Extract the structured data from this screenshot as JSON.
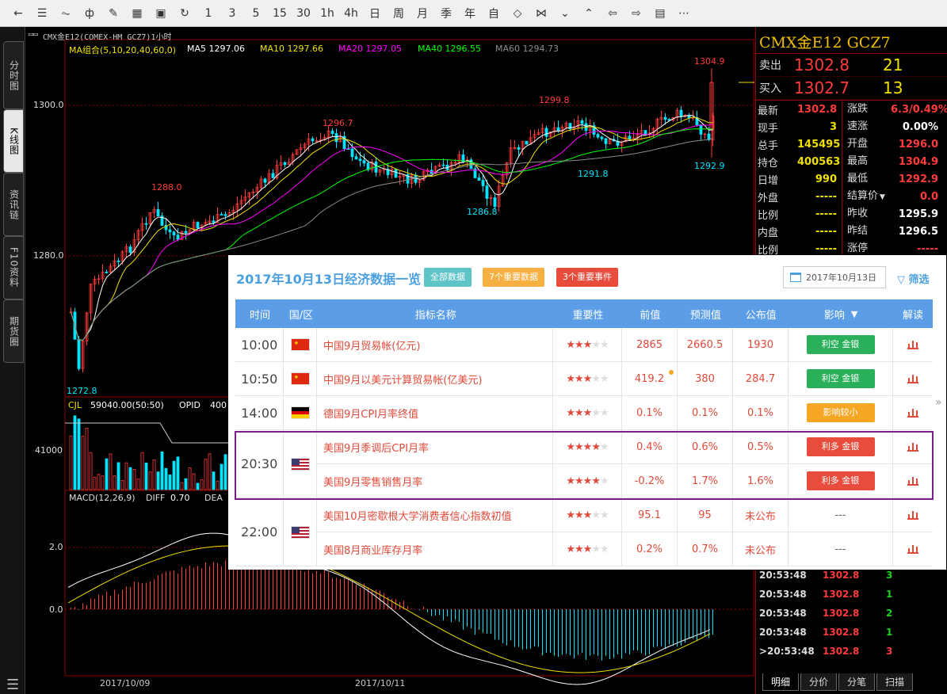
{
  "toolbar": {
    "items": [
      {
        "name": "back-icon",
        "glyph": "←"
      },
      {
        "name": "list-icon",
        "glyph": "☰"
      },
      {
        "name": "line-chart-icon",
        "glyph": "⏦"
      },
      {
        "name": "candle-icon",
        "glyph": "ф"
      },
      {
        "name": "draw-icon",
        "glyph": "✎"
      },
      {
        "name": "calc-icon",
        "glyph": "▦"
      },
      {
        "name": "save-icon",
        "glyph": "▣"
      },
      {
        "name": "refresh-icon",
        "glyph": "↻"
      },
      {
        "name": "period-1",
        "glyph": "1"
      },
      {
        "name": "period-3",
        "glyph": "3"
      },
      {
        "name": "period-5",
        "glyph": "5"
      },
      {
        "name": "period-15",
        "glyph": "15"
      },
      {
        "name": "period-30",
        "glyph": "30"
      },
      {
        "name": "period-1h",
        "glyph": "1h"
      },
      {
        "name": "period-4h",
        "glyph": "4h"
      },
      {
        "name": "period-day",
        "glyph": "日"
      },
      {
        "name": "period-week",
        "glyph": "周"
      },
      {
        "name": "period-month",
        "glyph": "月"
      },
      {
        "name": "period-quarter",
        "glyph": "季"
      },
      {
        "name": "period-year",
        "glyph": "年"
      },
      {
        "name": "period-custom",
        "glyph": "自"
      },
      {
        "name": "zoom-in-icon",
        "glyph": "◇"
      },
      {
        "name": "zoom-out-icon",
        "glyph": "⋈"
      },
      {
        "name": "down-icon",
        "glyph": "⌄"
      },
      {
        "name": "up-icon",
        "glyph": "⌃"
      },
      {
        "name": "left-icon",
        "glyph": "⇦"
      },
      {
        "name": "right-icon",
        "glyph": "⇨"
      },
      {
        "name": "layout-icon",
        "glyph": "▤"
      },
      {
        "name": "more-icon",
        "glyph": "⋯"
      }
    ]
  },
  "lefttabs": [
    "分时图",
    "K线图",
    "资讯链",
    "F10资料",
    "期货圈"
  ],
  "chart": {
    "title": "CMX金E12(COMEX-HM GCZ7)1小时",
    "ma_label": "MA组合(5,10,20,40,60,0)",
    "ma5": "MA5 1297.06",
    "ma10": "MA10 1297.66",
    "ma20": "MA20 1297.05",
    "ma40": "MA40 1296.55",
    "ma60": "MA60 1294.73",
    "y1": "1300.0",
    "y2": "1280.0",
    "peak1": "1288.0",
    "peak2": "1296.7",
    "peak3": "1299.8",
    "peak4": "1304.9",
    "low1": "1286.8",
    "low2": "1291.8",
    "low3": "1292.9",
    "low_left": "1272.8",
    "cjl_label": "CJL",
    "cjl_val": "59040.00(50:50)",
    "opid_label": "OPID",
    "opid_val": "400",
    "vol_y": "41000",
    "macd_label": "MACD(12,26,9)",
    "diff_label": "DIFF",
    "diff_val": "0.70",
    "dea_label": "DEA",
    "macd_y1": "2.0",
    "macd_y2": "0.0",
    "date1": "2017/10/09",
    "date2": "2017/10/11",
    "colors": {
      "up": "#ff3b3b",
      "down": "#00e5ff",
      "ma5": "#ffffff",
      "ma10": "#f0e000",
      "ma20": "#ff00ff",
      "ma40": "#00ff00",
      "ma60": "#8c8c8c"
    }
  },
  "quote": {
    "title": "CMX金E12  GCZ7",
    "sell_label": "卖出",
    "sell_price": "1302.8",
    "sell_vol": "21",
    "buy_label": "买入",
    "buy_price": "1302.7",
    "buy_vol": "13",
    "rows": [
      {
        "k1": "最新",
        "v1": "1302.8",
        "c1": "#ff3b3b",
        "k2": "涨跌",
        "v2": "6.3/0.49%",
        "c2": "#ff3b3b"
      },
      {
        "k1": "现手",
        "v1": "3",
        "c1": "#f0e000",
        "k2": "速涨",
        "v2": "0.00%",
        "c2": "#ffffff"
      },
      {
        "k1": "总手",
        "v1": "145495",
        "c1": "#f0e000",
        "k2": "开盘",
        "v2": "1296.0",
        "c2": "#ff3b3b"
      },
      {
        "k1": "持仓",
        "v1": "400563",
        "c1": "#f0e000",
        "k2": "最高",
        "v2": "1304.9",
        "c2": "#ff3b3b"
      },
      {
        "k1": "日增",
        "v1": "990",
        "c1": "#f0e000",
        "k2": "最低",
        "v2": "1292.9",
        "c2": "#ff3b3b"
      },
      {
        "k1": "外盘",
        "v1": "-----",
        "c1": "#f0e000",
        "k2": "结算价",
        "v2": "0.0",
        "c2": "#ff3b3b"
      },
      {
        "k1": "比例",
        "v1": "-----",
        "c1": "#f0e000",
        "k2": "昨收",
        "v2": "1295.9",
        "c2": "#ffffff"
      },
      {
        "k1": "内盘",
        "v1": "-----",
        "c1": "#f0e000",
        "k2": "昨结",
        "v2": "1296.5",
        "c2": "#ffffff"
      },
      {
        "k1": "比例",
        "v1": "-----",
        "c1": "#f0e000",
        "k2": "涨停",
        "v2": "-----",
        "c2": "#ff3b3b"
      }
    ],
    "ticks": [
      {
        "t": "20:53:48",
        "p": "1302.8",
        "v": "3",
        "red": false
      },
      {
        "t": "20:53:48",
        "p": "1302.8",
        "v": "1",
        "red": false
      },
      {
        "t": "20:53:48",
        "p": "1302.8",
        "v": "2",
        "red": false
      },
      {
        "t": "20:53:48",
        "p": "1302.8",
        "v": "1",
        "red": false
      },
      {
        "t": ">20:53:48",
        "p": "1302.8",
        "v": "3",
        "red": true
      }
    ],
    "bottomtabs": [
      "明细",
      "分价",
      "分笔",
      "扫描"
    ]
  },
  "econ": {
    "title": "2017年10月13日经济数据一览",
    "pill_all": "全部数据",
    "pill_important": "7个重要数据",
    "pill_events": "3个重要事件",
    "date": "2017年10月13日",
    "filter": "筛选",
    "headers": {
      "time": "时间",
      "region": "国/区",
      "name": "指标名称",
      "importance": "重要性",
      "prev": "前值",
      "forecast": "预测值",
      "actual": "公布值",
      "impact": "影响",
      "read": "解读"
    },
    "colors": {
      "bearish": "#2ab05a",
      "bullish": "#e74c3c",
      "neutral": "#f5a623"
    },
    "groups": [
      {
        "time": "10:00",
        "flag": "cn",
        "rows": [
          {
            "name": "中国9月贸易帐(亿元)",
            "stars": 3,
            "prev": "2865",
            "forecast": "2660.5",
            "actual": "1930",
            "impact": "利空 金银",
            "impact_type": "bearish"
          }
        ]
      },
      {
        "time": "10:50",
        "flag": "cn",
        "rows": [
          {
            "name": "中国9月以美元计算贸易帐(亿美元)",
            "stars": 3,
            "prev": "419.2",
            "forecast": "380",
            "actual": "284.7",
            "impact": "利空 金银",
            "impact_type": "bearish",
            "dot": true
          }
        ]
      },
      {
        "time": "14:00",
        "flag": "de",
        "rows": [
          {
            "name": "德国9月CPI月率终值",
            "stars": 3,
            "prev": "0.1%",
            "forecast": "0.1%",
            "actual": "0.1%",
            "impact": "影响较小",
            "impact_type": "neutral"
          }
        ]
      },
      {
        "time": "20:30",
        "flag": "us",
        "rows": [
          {
            "name": "美国9月季调后CPI月率",
            "stars": 4,
            "prev": "0.4%",
            "forecast": "0.6%",
            "actual": "0.5%",
            "impact": "利多 金银",
            "impact_type": "bullish"
          },
          {
            "name": "美国9月零售销售月率",
            "stars": 4,
            "prev": "-0.2%",
            "forecast": "1.7%",
            "actual": "1.6%",
            "impact": "利多 金银",
            "impact_type": "bullish"
          }
        ]
      },
      {
        "time": "22:00",
        "flag": "us",
        "rows": [
          {
            "name": "美国10月密歇根大学消费者信心指数初值",
            "stars": 3,
            "prev": "95.1",
            "forecast": "95",
            "actual": "未公布",
            "impact": "---",
            "impact_type": "none"
          },
          {
            "name": "美国8月商业库存月率",
            "stars": 3,
            "prev": "0.2%",
            "forecast": "0.7%",
            "actual": "未公布",
            "impact": "---",
            "impact_type": "none"
          }
        ]
      }
    ]
  }
}
